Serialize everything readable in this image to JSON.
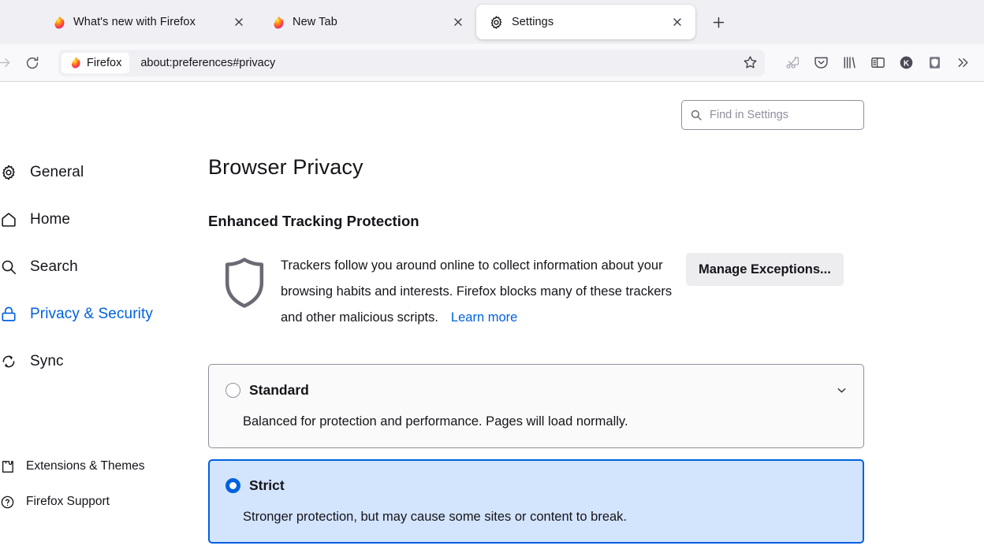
{
  "window": {
    "traffic_light_green": "#28c840"
  },
  "tabs": {
    "items": [
      {
        "title": "What's new with Firefox",
        "favicon": "firefox-logo-icon",
        "active": false,
        "close_icon": "close-icon"
      },
      {
        "title": "New Tab",
        "favicon": "firefox-logo-icon",
        "active": false,
        "close_icon": "close-icon"
      },
      {
        "title": "Settings",
        "favicon": "gear-icon",
        "active": true,
        "close_icon": "close-icon"
      }
    ],
    "new_tab_label": "+",
    "new_tab_icon": "plus-icon"
  },
  "toolbar": {
    "back_icon": "arrow-left-icon",
    "forward_icon": "arrow-right-icon",
    "reload_icon": "reload-icon",
    "identity_chip_label": "Firefox",
    "identity_chip_icon": "firefox-logo-icon",
    "url": "about:preferences#privacy",
    "bookmark_icon": "star-icon",
    "screenshot_icon": "scissors-icon",
    "right_icons": [
      {
        "name": "pocket-icon",
        "label": "Pocket"
      },
      {
        "name": "library-icon",
        "label": "Library"
      },
      {
        "name": "sidebar-icon",
        "label": "Sidebar"
      },
      {
        "name": "kagi-extension-icon",
        "label": "K"
      },
      {
        "name": "shield-extension-icon",
        "label": "Shield"
      },
      {
        "name": "overflow-chevrons-icon",
        "label": "More tools"
      }
    ]
  },
  "sidebar": {
    "items": [
      {
        "label": "General",
        "icon": "gear-icon",
        "selected": false
      },
      {
        "label": "Home",
        "icon": "home-icon",
        "selected": false
      },
      {
        "label": "Search",
        "icon": "search-icon",
        "selected": false
      },
      {
        "label": "Privacy & Security",
        "icon": "lock-icon",
        "selected": true
      },
      {
        "label": "Sync",
        "icon": "sync-icon",
        "selected": false
      }
    ],
    "footer": [
      {
        "label": "Extensions & Themes",
        "icon": "puzzle-icon"
      },
      {
        "label": "Firefox Support",
        "icon": "help-circle-icon"
      }
    ],
    "accent_color": "#0061e0"
  },
  "search": {
    "placeholder": "Find in Settings",
    "icon": "search-icon",
    "value": ""
  },
  "main": {
    "page_title": "Browser Privacy",
    "section_title": "Enhanced Tracking Protection",
    "shield_icon": "shield-icon",
    "description": "Trackers follow you around online to collect information about your browsing habits and interests. Firefox blocks many of these trackers and other malicious scripts.",
    "learn_more_label": "Learn more",
    "manage_exceptions_label": "Manage Exceptions...",
    "options": [
      {
        "name": "Standard",
        "description": "Balanced for protection and performance. Pages will load normally.",
        "selected": false,
        "expander_icon": "chevron-down-icon"
      },
      {
        "name": "Strict",
        "description": "Stronger protection, but may cause some sites or content to break.",
        "selected": true,
        "expander_icon": null
      }
    ],
    "selected_card_bg": "#d3e4fd",
    "selected_card_border": "#0061e0"
  }
}
